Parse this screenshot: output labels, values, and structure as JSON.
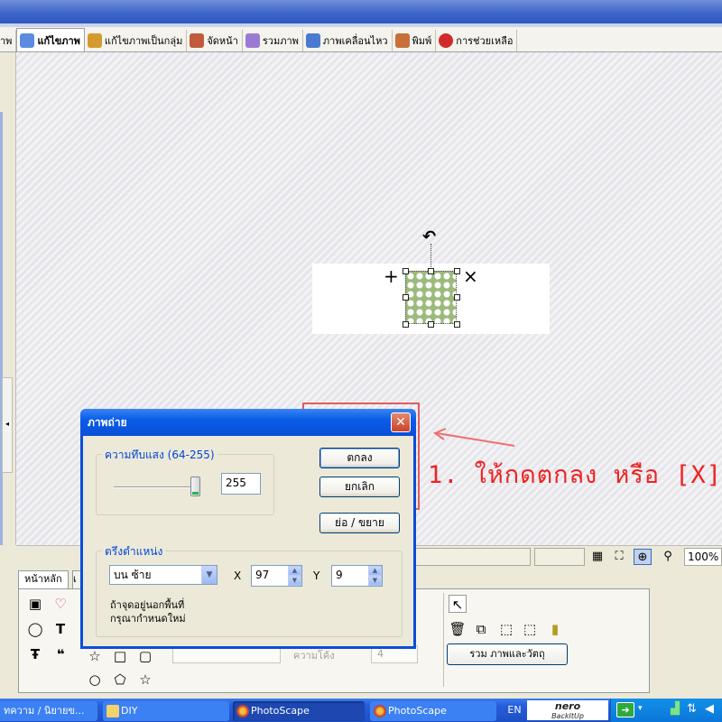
{
  "app": {
    "tabs": [
      {
        "label": "าพ",
        "icon": "viewer-icon",
        "color": "#8c8c8c"
      },
      {
        "label": "แก้ไขภาพ",
        "icon": "editor-icon",
        "color": "#5a8de0",
        "active": true
      },
      {
        "label": "แก้ไขภาพเป็นกลุ่ม",
        "icon": "batch-editor-icon",
        "color": "#d59a2f"
      },
      {
        "label": "จัดหน้า",
        "icon": "page-icon",
        "color": "#c05a3a"
      },
      {
        "label": "รวมภาพ",
        "icon": "combine-icon",
        "color": "#9b7ad4"
      },
      {
        "label": "ภาพเคลื่อนไหว",
        "icon": "animated-gif-icon",
        "color": "#4a7bd0"
      },
      {
        "label": "พิมพ์",
        "icon": "print-icon",
        "color": "#c8703a"
      },
      {
        "label": "การช่วยเหลือ",
        "icon": "help-icon",
        "color": "#d22a2a"
      }
    ]
  },
  "canvas": {
    "annotation_text": "1. ให้กดตกลง หรือ [X]",
    "annotation_color": "#ee2222"
  },
  "status": {
    "zoom": "100%"
  },
  "bottom_panel": {
    "tab_home": "หน้าหลัก",
    "tab_second": "เ",
    "combine_button": "รวม ภาพและวัตถุ",
    "faded_label": "ความโค้ง",
    "faded_value": "4"
  },
  "dialog": {
    "title": "ภาพถ่าย",
    "opacity_group_label": "ความทึบแสง (64-255)",
    "opacity_value": "255",
    "opacity_fraction": 1.0,
    "ok_button": "ตกลง",
    "cancel_button": "ยกเลิก",
    "resize_button": "ย่อ / ขยาย",
    "position_group_label": "ตรึงตำแหน่ง",
    "anchor_selected": "บน ซ้าย",
    "x_label": "X",
    "x_value": "97",
    "y_label": "Y",
    "y_value": "9",
    "note_line1": "ถ้าจุดอยู่นอกพื้นที่",
    "note_line2": "กรุณากำหนดใหม่"
  },
  "taskbar": {
    "items": [
      {
        "label": "ทความ / นิยายข...",
        "icon": "browser-icon"
      },
      {
        "label": "DIY",
        "icon": "folder-icon"
      },
      {
        "label": "PhotoScape",
        "icon": "photoscape-icon",
        "active": true
      },
      {
        "label": "PhotoScape",
        "icon": "photoscape-icon"
      }
    ],
    "lang": "EN",
    "nero_text": "nero",
    "nero_sub": "BackItUp"
  }
}
